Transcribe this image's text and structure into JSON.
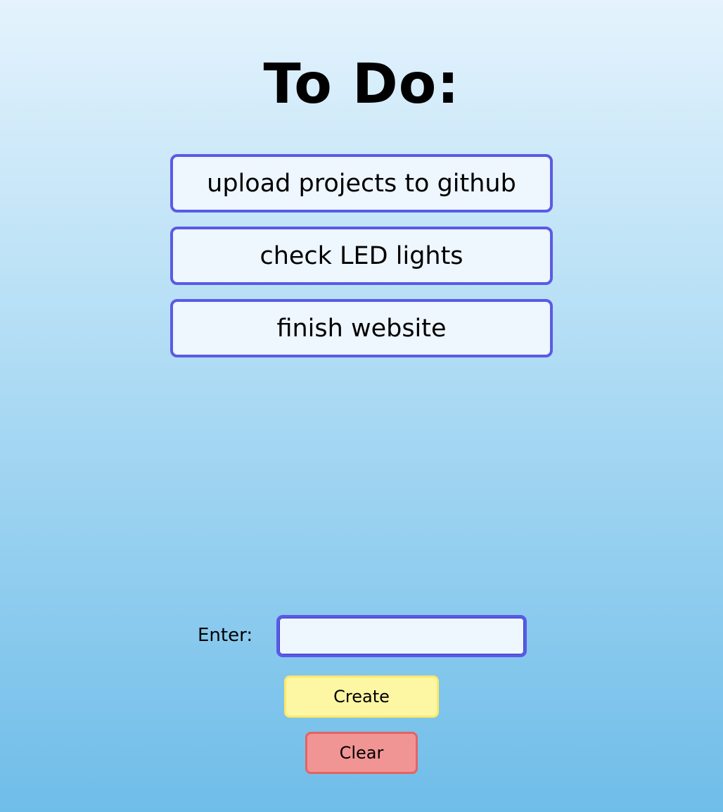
{
  "page": {
    "title": "To Do:"
  },
  "todos": [
    {
      "text": "upload projects to github"
    },
    {
      "text": "check LED lights"
    },
    {
      "text": "finish website"
    }
  ],
  "form": {
    "enter_label": "Enter:",
    "input_value": "",
    "create_label": "Create",
    "clear_label": "Clear"
  },
  "colors": {
    "item_border": "#5a5ae6",
    "item_background": "#eef6fe",
    "create_background": "#fdf7a3",
    "create_border": "#fae96a",
    "clear_background": "#f19494",
    "clear_border": "#e46363",
    "background_top": "#e4f3fd",
    "background_bottom": "#6fbde9"
  }
}
